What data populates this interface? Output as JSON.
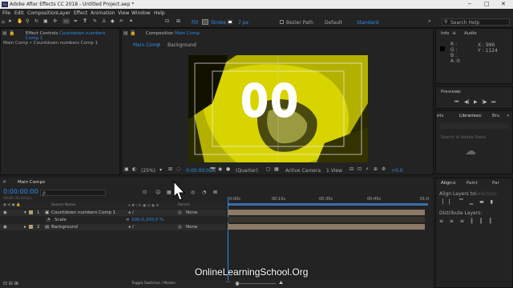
{
  "window": {
    "title": "Adobe After Effects CC 2018 - Untitled Project.aep *",
    "minimize": "─",
    "maximize": "□",
    "close": "✕"
  },
  "menu": [
    "File",
    "Edit",
    "Composition",
    "Layer",
    "Effect",
    "Animation",
    "View",
    "Window",
    "Help"
  ],
  "toolbar": {
    "fill_label": "Fill",
    "stroke_label": "Stroke",
    "stroke_px": "7 px",
    "bezier_label": "Bezier Path",
    "default_label": "Default",
    "standard_label": "Standard",
    "search_placeholder": "Search Help"
  },
  "effect_controls": {
    "tab_prefix": "Effect Controls",
    "tab_comp": "Countdown numbers Comp 1",
    "breadcrumb": "Main Comp • Countdown numbers Comp 1"
  },
  "composition": {
    "tab_prefix": "Composition",
    "tab_name": "Main Comp",
    "sub_tab_main": "Main Comp",
    "sub_tab_background": "Background",
    "overlay_text": "00",
    "zoom": "(25%)",
    "timecode": "0:00:00:00",
    "resolution": "(Quarter)",
    "camera": "Active Camera",
    "views": "1 View",
    "exposure": "+0.0"
  },
  "info": {
    "tab_info": "Info",
    "tab_audio": "Audio",
    "r": "R :",
    "g": "G :",
    "b": "B :",
    "a": "A :",
    "a_val": "0",
    "x": "X : 996",
    "y": "Y : 1124"
  },
  "preview": {
    "tab": "Preview"
  },
  "libraries": {
    "tab_effects": "ets",
    "tab_libraries": "Libraries",
    "tab_brushes": "Bru",
    "search_placeholder": "Search in Adobe Stock"
  },
  "align": {
    "tab_align": "Align",
    "tab_paint": "Paint",
    "tab_para": "Par",
    "align_to_label": "Align Layers to:",
    "align_to_value": "Selection",
    "distribute_label": "Distribute Layers:"
  },
  "timeline": {
    "tab": "Main Comp",
    "timecode": "0:00:00:00",
    "timecode_sub": "00000 (30.00 fps)",
    "search_placeholder": "ρ",
    "col_source": "Source Name",
    "col_parent": "Parent",
    "rulers": [
      "0:00s",
      "00:15s",
      "00:30s",
      "00:45s",
      "01:0"
    ],
    "layers": [
      {
        "num": "1",
        "name": "Countdown numbers Comp 1",
        "parent": "None"
      },
      {
        "num": "",
        "name": "Scale",
        "value": "100.0,100.0 %",
        "parent": ""
      },
      {
        "num": "2",
        "name": "Background",
        "parent": "None"
      }
    ],
    "toggle_label": "Toggle Switches / Modes"
  },
  "watermark": "OnlineLearningSchool.Org",
  "colors": {
    "accent": "#2d8ceb",
    "track": "#8a7a66",
    "overlay": "#d8d400"
  }
}
